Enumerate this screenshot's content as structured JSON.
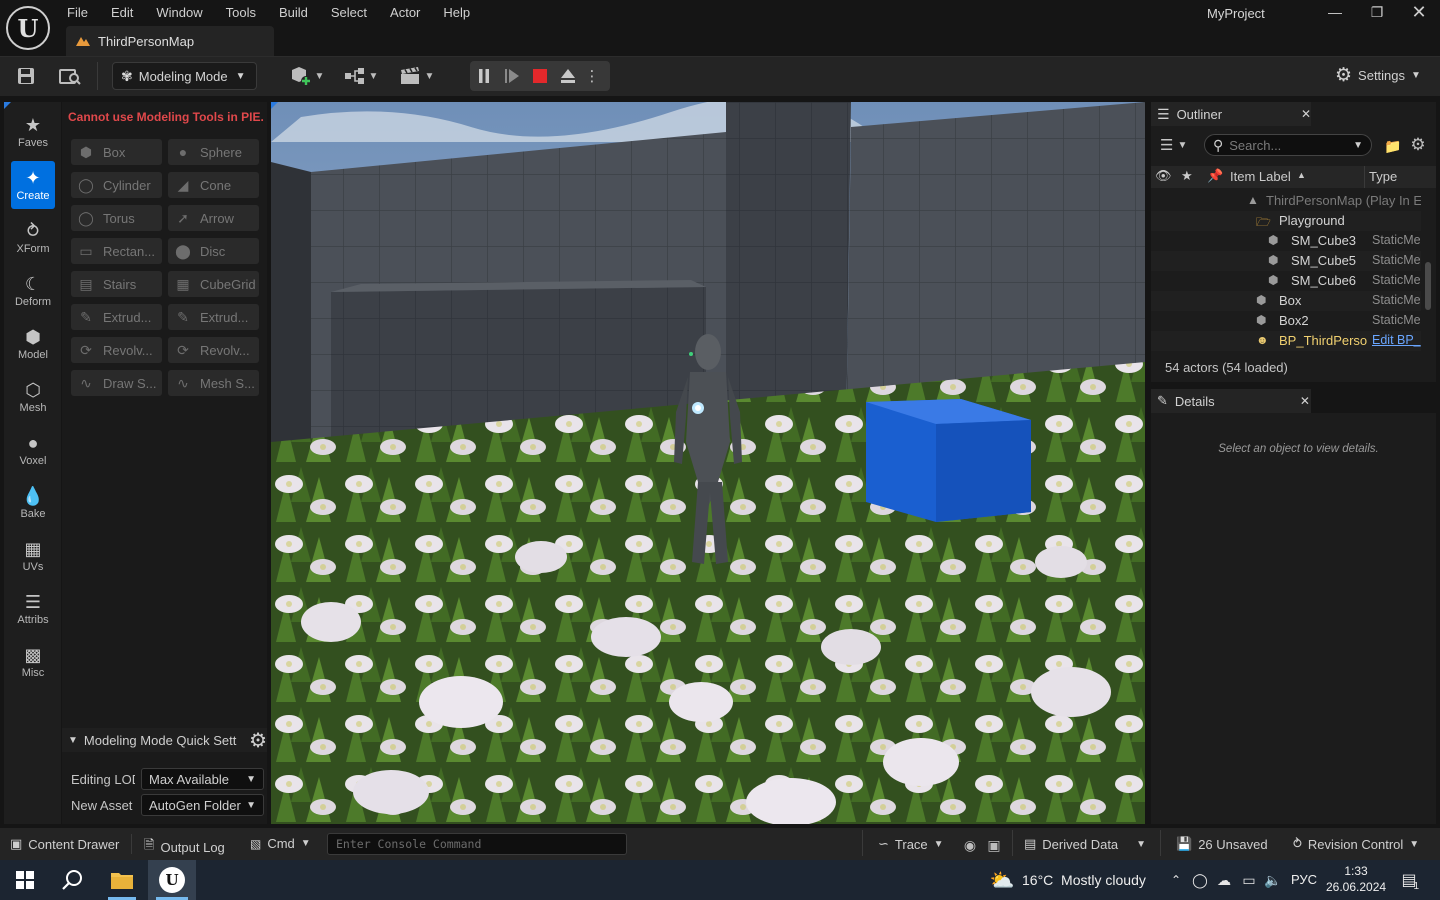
{
  "window": {
    "menu": [
      "File",
      "Edit",
      "Window",
      "Tools",
      "Build",
      "Select",
      "Actor",
      "Help"
    ],
    "map_tab": "ThirdPersonMap",
    "project": "MyProject"
  },
  "toolbar": {
    "mode_label": "Modeling Mode",
    "settings_label": "Settings"
  },
  "modes": [
    {
      "label": "Faves",
      "icon": "star-icon"
    },
    {
      "label": "Create",
      "icon": "create-icon",
      "active": true
    },
    {
      "label": "XForm",
      "icon": "xform-icon"
    },
    {
      "label": "Deform",
      "icon": "deform-icon"
    },
    {
      "label": "Model",
      "icon": "model-icon"
    },
    {
      "label": "Mesh",
      "icon": "mesh-icon"
    },
    {
      "label": "Voxel",
      "icon": "voxel-icon"
    },
    {
      "label": "Bake",
      "icon": "bake-icon"
    },
    {
      "label": "UVs",
      "icon": "uvs-icon"
    },
    {
      "label": "Attribs",
      "icon": "attribs-icon"
    },
    {
      "label": "Misc",
      "icon": "misc-icon"
    }
  ],
  "tools": {
    "warning": "Cannot use Modeling Tools in PIE.",
    "buttons": [
      {
        "label": "Box",
        "icon": "box-icon"
      },
      {
        "label": "Sphere",
        "icon": "sphere-icon"
      },
      {
        "label": "Cylinder",
        "icon": "cylinder-icon"
      },
      {
        "label": "Cone",
        "icon": "cone-icon"
      },
      {
        "label": "Torus",
        "icon": "torus-icon"
      },
      {
        "label": "Arrow",
        "icon": "arrow-icon"
      },
      {
        "label": "Rectan...",
        "icon": "rectangle-icon"
      },
      {
        "label": "Disc",
        "icon": "disc-icon"
      },
      {
        "label": "Stairs",
        "icon": "stairs-icon"
      },
      {
        "label": "CubeGrid",
        "icon": "cubegrid-icon"
      },
      {
        "label": "Extrud...",
        "icon": "extrude-path-icon"
      },
      {
        "label": "Extrud...",
        "icon": "extrude-polygon-icon"
      },
      {
        "label": "Revolv...",
        "icon": "revolve-path-icon"
      },
      {
        "label": "Revolv...",
        "icon": "revolve-boundary-icon"
      },
      {
        "label": "Draw S...",
        "icon": "draw-spline-icon"
      },
      {
        "label": "Mesh S...",
        "icon": "mesh-spline-icon"
      }
    ]
  },
  "quick_settings": {
    "title": "Modeling Mode Quick Sett",
    "editing_lod_label": "Editing LOD",
    "editing_lod_value": "Max Available",
    "new_asset_label": "New Asset",
    "new_asset_value": "AutoGen Folder"
  },
  "outliner": {
    "title": "Outliner",
    "search_placeholder": "Search...",
    "col_label": "Item Label",
    "col_type": "Type",
    "rows": [
      {
        "label": "ThirdPersonMap (Play In E",
        "type": "",
        "indent": 1,
        "icon": "map-icon",
        "dim": true
      },
      {
        "label": "Playground",
        "type": "",
        "indent": 2,
        "icon": "folder-icon"
      },
      {
        "label": "SM_Cube3",
        "type": "StaticMe",
        "indent": 3,
        "icon": "static-mesh-icon"
      },
      {
        "label": "SM_Cube5",
        "type": "StaticMe",
        "indent": 3,
        "icon": "static-mesh-icon"
      },
      {
        "label": "SM_Cube6",
        "type": "StaticMe",
        "indent": 3,
        "icon": "static-mesh-icon"
      },
      {
        "label": "Box",
        "type": "StaticMe",
        "indent": 2,
        "icon": "static-mesh-icon"
      },
      {
        "label": "Box2",
        "type": "StaticMe",
        "indent": 2,
        "icon": "static-mesh-icon"
      },
      {
        "label": "BP_ThirdPerso",
        "type": "Edit BP_",
        "indent": 2,
        "icon": "character-icon",
        "highlight": true
      }
    ],
    "actors_count": "54 actors (54 loaded)"
  },
  "details": {
    "title": "Details",
    "empty_text": "Select an object to view details."
  },
  "statusbar": {
    "content_drawer": "Content Drawer",
    "output_log": "Output Log",
    "cmd": "Cmd",
    "console_placeholder": "Enter Console Command",
    "trace": "Trace",
    "derived_data": "Derived Data",
    "unsaved": "26 Unsaved",
    "revision_control": "Revision Control"
  },
  "taskbar": {
    "weather": "16°C  Mostly cloudy",
    "lang": "РУС",
    "time": "1:33",
    "date": "26.06.2024",
    "notifications": "1"
  },
  "colors": {
    "accent": "#0070e0",
    "warning": "#e0484b",
    "cube": "#1a5fd0"
  }
}
